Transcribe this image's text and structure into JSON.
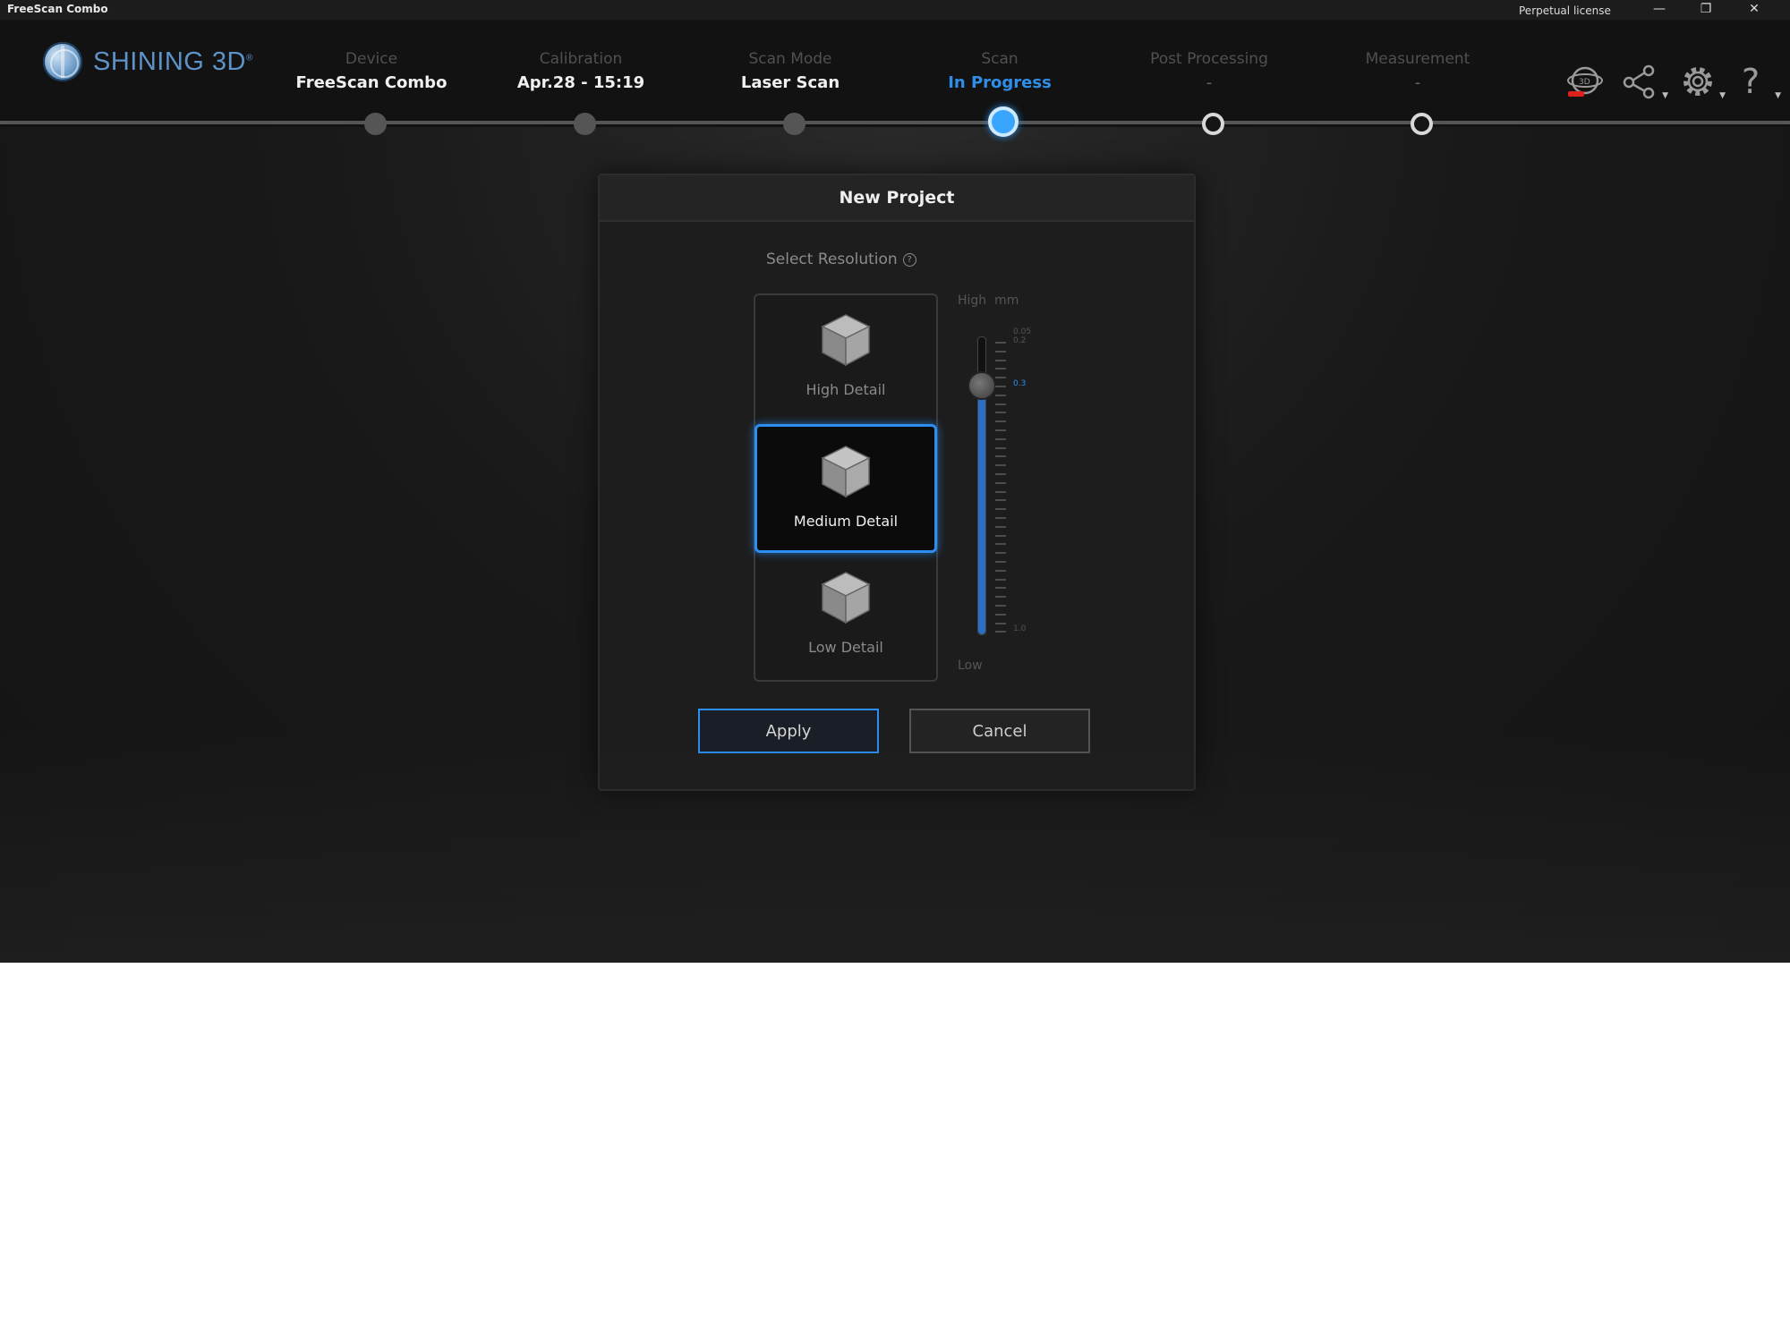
{
  "window": {
    "title": "FreeScan Combo",
    "license": "Perpetual license",
    "controls": {
      "minimize": "—",
      "restore": "❐",
      "close": "✕"
    }
  },
  "brand": {
    "name": "SHINING 3D",
    "mark": "®"
  },
  "steps": [
    {
      "label": "Device",
      "value": "FreeScan Combo",
      "state": "done"
    },
    {
      "label": "Calibration",
      "value": "Apr.28 - 15:19",
      "state": "done"
    },
    {
      "label": "Scan Mode",
      "value": "Laser Scan",
      "state": "done"
    },
    {
      "label": "Scan",
      "value": "In Progress",
      "state": "current"
    },
    {
      "label": "Post Processing",
      "value": "-",
      "state": "future"
    },
    {
      "label": "Measurement",
      "value": "-",
      "state": "future"
    }
  ],
  "toolbar": {
    "icons": [
      "device-360-icon",
      "share-icon",
      "settings-icon",
      "help-icon"
    ],
    "badge_color": "#e0201c"
  },
  "dialog": {
    "title": "New Project",
    "select_resolution": "Select Resolution",
    "options": [
      {
        "label": "High Detail",
        "selected": false
      },
      {
        "label": "Medium Detail",
        "selected": true
      },
      {
        "label": "Low Detail",
        "selected": false
      }
    ],
    "slider": {
      "high_label": "High",
      "unit": "mm",
      "low_label": "Low",
      "tick_top": "0.05",
      "tick_top2": "0.2",
      "current": "0.3",
      "tick_bottom": "1.0",
      "level": 0.84
    },
    "apply": "Apply",
    "cancel": "Cancel"
  },
  "colors": {
    "accent": "#2b8ef0",
    "active_step": "#2f8fe8"
  }
}
